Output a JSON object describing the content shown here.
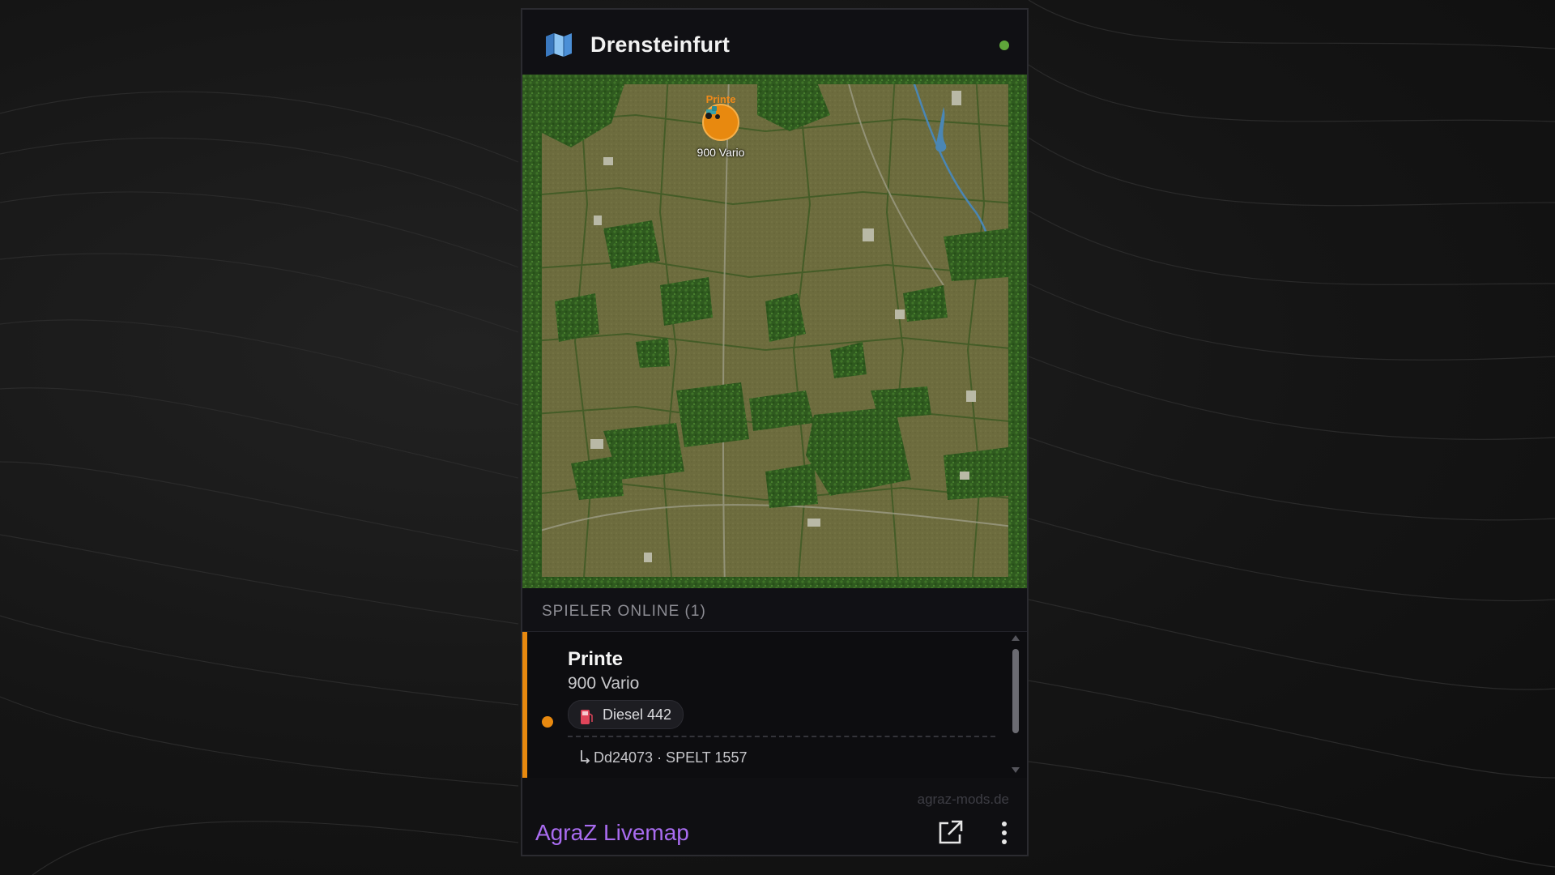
{
  "widget": {
    "title": "Drensteinfurt",
    "status_color": "#5fa63a",
    "icons": {
      "header": "map-icon",
      "status": "online-status-dot"
    }
  },
  "map": {
    "marker": {
      "player_name": "Printe",
      "vehicle": "900 Vario",
      "color": "#e8890f",
      "icon": "tractor-icon"
    }
  },
  "players": {
    "header": "SPIELER ONLINE (1)",
    "list": [
      {
        "name": "Printe",
        "vehicle": "900 Vario",
        "fuel_label": "Diesel 442",
        "fuel_icon": "fuel-pump-icon",
        "attachment": "Dd24073 · SPELT 1557",
        "color": "#e8890f"
      }
    ]
  },
  "footer": {
    "site": "agraz-mods.de",
    "brand": "AgraZ Livemap",
    "brand_color": "#a96cf0",
    "icons": {
      "open": "external-link-icon",
      "menu": "more-vertical-icon"
    }
  }
}
